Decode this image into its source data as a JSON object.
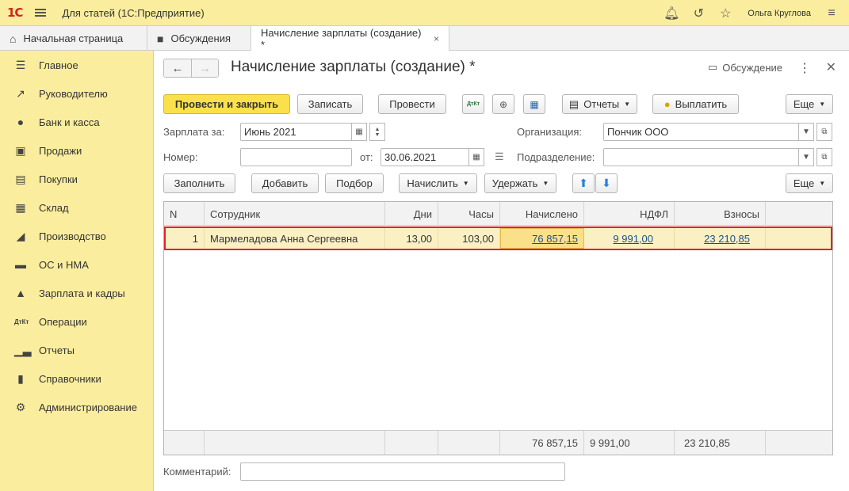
{
  "app": {
    "logo": "1С",
    "title": "Для статей  (1С:Предприятие)",
    "user": "Ольга Круглова"
  },
  "tabs": [
    {
      "label": "Начальная страница",
      "icon": "home-icon"
    },
    {
      "label": "Обсуждения",
      "icon": "chat-icon"
    },
    {
      "label": "Начисление зарплаты (создание) *",
      "close": "×"
    }
  ],
  "sidebar": {
    "items": [
      {
        "label": "Главное",
        "icon": "menu-lines-icon"
      },
      {
        "label": "Руководителю",
        "icon": "trend-icon"
      },
      {
        "label": "Банк и касса",
        "icon": "coin-icon"
      },
      {
        "label": "Продажи",
        "icon": "bag-icon"
      },
      {
        "label": "Покупки",
        "icon": "cart-icon"
      },
      {
        "label": "Склад",
        "icon": "warehouse-icon"
      },
      {
        "label": "Производство",
        "icon": "factory-icon"
      },
      {
        "label": "ОС и НМА",
        "icon": "truck-icon"
      },
      {
        "label": "Зарплата и кадры",
        "icon": "person-icon"
      },
      {
        "label": "Операции",
        "icon": "dt-kt-icon"
      },
      {
        "label": "Отчеты",
        "icon": "bar-chart-icon"
      },
      {
        "label": "Справочники",
        "icon": "book-icon"
      },
      {
        "label": "Администрирование",
        "icon": "gear-icon"
      }
    ]
  },
  "doc": {
    "title": "Начисление зарплаты (создание) *",
    "discuss": "Обсуждение",
    "toolbar": {
      "post_close": "Провести и закрыть",
      "save": "Записать",
      "post": "Провести",
      "dt_kt": "ДтКт",
      "reports": "Отчеты",
      "pay": "Выплатить",
      "more": "Еще"
    },
    "fields": {
      "salary_for_label": "Зарплата за:",
      "salary_for_value": "Июнь 2021",
      "org_label": "Организация:",
      "org_value": "Пончик ООО",
      "number_label": "Номер:",
      "number_value": "",
      "from_label": "от:",
      "from_value": "30.06.2021",
      "dept_label": "Подразделение:",
      "dept_value": "",
      "comment_label": "Комментарий:",
      "comment_value": ""
    },
    "table_toolbar": {
      "fill": "Заполнить",
      "add": "Добавить",
      "select": "Подбор",
      "accrue": "Начислить",
      "withhold": "Удержать",
      "more": "Еще"
    },
    "table": {
      "headers": [
        "N",
        "Сотрудник",
        "Дни",
        "Часы",
        "Начислено",
        "НДФЛ",
        "Взносы"
      ],
      "rows": [
        {
          "n": "1",
          "employee": "Мармеладова Анна Сергеевна",
          "days": "13,00",
          "hours": "103,00",
          "accrued": "76 857,15",
          "ndfl": "9 991,00",
          "contrib": "23 210,85"
        }
      ],
      "totals": {
        "accrued": "76 857,15",
        "ndfl": "9 991,00",
        "contrib": "23 210,85"
      }
    }
  }
}
